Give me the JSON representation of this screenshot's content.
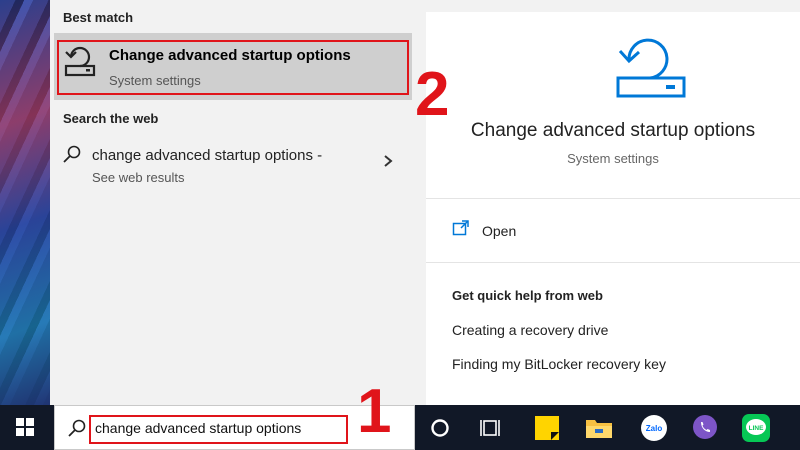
{
  "search_panel": {
    "best_match": {
      "header": "Best match",
      "item": {
        "title": "Change advanced startup options",
        "subtitle": "System settings",
        "icon": "startup-recovery-icon"
      }
    },
    "search_web": {
      "header": "Search the web",
      "item": {
        "title": "change advanced startup options -",
        "subtitle": "See web results",
        "icon": "search-icon"
      }
    }
  },
  "preview": {
    "title": "Change advanced startup options",
    "subtitle": "System settings",
    "actions": [
      {
        "label": "Open",
        "icon": "open-window-icon"
      }
    ],
    "help": {
      "header": "Get quick help from web",
      "links": [
        "Creating a recovery drive",
        "Finding my BitLocker recovery key"
      ]
    }
  },
  "taskbar": {
    "search_text": "change advanced startup options",
    "icons": [
      "windows-start-icon",
      "cortana-icon",
      "task-view-icon",
      "sticky-notes-icon",
      "file-explorer-icon",
      "zalo-icon",
      "viber-icon",
      "line-icon"
    ],
    "zalo_label": "Zalo",
    "line_label": "LINE"
  },
  "annotations": {
    "step1": "1",
    "step2": "2",
    "highlight_color": "#e0141a"
  },
  "colors": {
    "accent": "#0078d7",
    "panel_bg": "#f2f2f2",
    "selected_bg": "#cfcfcf",
    "taskbar_bg": "#111827"
  }
}
